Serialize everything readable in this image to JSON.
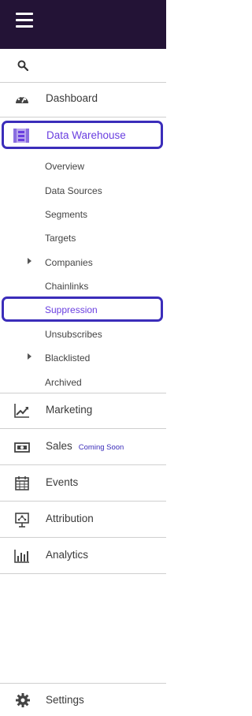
{
  "nav": {
    "dashboard": "Dashboard",
    "data_warehouse": "Data Warehouse",
    "marketing": "Marketing",
    "sales": "Sales",
    "sales_badge": "Coming Soon",
    "events": "Events",
    "attribution": "Attribution",
    "analytics": "Analytics",
    "settings": "Settings"
  },
  "data_warehouse_items": {
    "overview": "Overview",
    "data_sources": "Data Sources",
    "segments": "Segments",
    "targets": "Targets",
    "companies": "Companies",
    "chainlinks": "Chainlinks",
    "suppression": "Suppression",
    "unsubscribes": "Unsubscribes",
    "blacklisted": "Blacklisted",
    "archived": "Archived"
  },
  "colors": {
    "topbar": "#231336",
    "highlight_border": "#3b2dba",
    "active_text": "#6a3fe0"
  },
  "icons": {
    "menu": "hamburger-menu-icon",
    "search": "search-icon",
    "dashboard": "speedometer-icon",
    "data_warehouse": "database-icon",
    "marketing": "trend-line-icon",
    "sales": "cash-icon",
    "events": "calendar-icon",
    "attribution": "presentation-icon",
    "analytics": "bar-chart-icon",
    "settings": "gear-icon"
  }
}
